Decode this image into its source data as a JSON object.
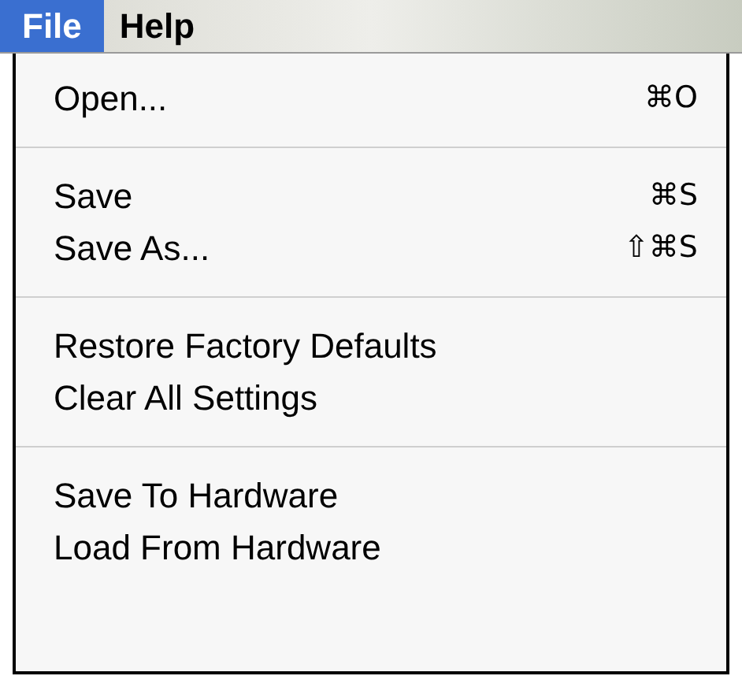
{
  "menu_bar": [
    {
      "label": "File",
      "selected": true
    },
    {
      "label": "Help",
      "selected": false
    }
  ],
  "menu": [
    {
      "kind": "item",
      "label": "Open...",
      "shortcut": "⌘O"
    },
    {
      "kind": "separator"
    },
    {
      "kind": "item",
      "label": "Save",
      "shortcut": "⌘S"
    },
    {
      "kind": "item",
      "label": "Save As...",
      "shortcut": "⇧⌘S"
    },
    {
      "kind": "separator"
    },
    {
      "kind": "item",
      "label": "Restore Factory Defaults"
    },
    {
      "kind": "item",
      "label": "Clear All Settings"
    },
    {
      "kind": "separator"
    },
    {
      "kind": "item",
      "label": "Save To Hardware"
    },
    {
      "kind": "item",
      "label": "Load From Hardware"
    }
  ]
}
